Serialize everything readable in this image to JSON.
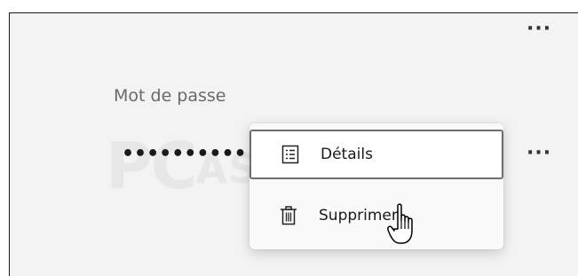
{
  "header": {
    "more_label": "···"
  },
  "password_field": {
    "label": "Mot de passe",
    "masked_value": "••••••••••",
    "more_label": "···"
  },
  "watermark": {
    "text_main": "PC",
    "text_sub": "ASTUCES"
  },
  "context_menu": {
    "items": [
      {
        "label": "Détails",
        "icon": "list-details-icon"
      },
      {
        "label": "Supprimer",
        "icon": "trash-icon"
      }
    ]
  },
  "colors": {
    "panel_background": "#f3f3f3",
    "menu_background": "#f9f9f9",
    "focus_border": "#6e6e6e"
  }
}
